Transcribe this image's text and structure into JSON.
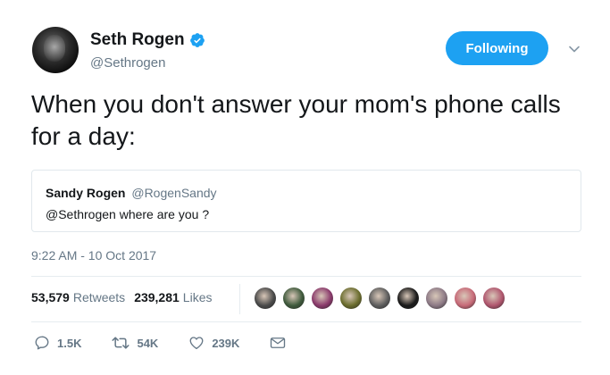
{
  "header": {
    "display_name": "Seth Rogen",
    "handle": "@Sethrogen",
    "verified_icon": "verified-badge-icon",
    "follow_label": "Following",
    "menu_icon": "chevron-down-icon"
  },
  "tweet": {
    "text": "When you don't answer your mom's phone calls for a day:"
  },
  "quote": {
    "name": "Sandy Rogen",
    "handle": "@RogenSandy",
    "text": "@Sethrogen where are you ?"
  },
  "meta": {
    "timestamp": "9:22 AM - 10 Oct 2017"
  },
  "stats": {
    "retweets_count": "53,579",
    "retweets_label": "Retweets",
    "likes_count": "239,281",
    "likes_label": "Likes",
    "liker_avatars": [
      "#4a4a4a",
      "#3f5a3c",
      "#8a3a6b",
      "#6b6d2e",
      "#5e5e5e",
      "#1a1a1a",
      "#8d7a86",
      "#c76a78",
      "#b0566e"
    ]
  },
  "actions": {
    "reply_count": "1.5K",
    "retweet_count": "54K",
    "like_count": "239K",
    "icons": [
      "reply-icon",
      "retweet-icon",
      "heart-icon",
      "message-icon"
    ]
  },
  "colors": {
    "accent": "#1da1f2",
    "secondary_text": "#657786",
    "primary_text": "#14171a",
    "border": "#e1e8ed"
  }
}
